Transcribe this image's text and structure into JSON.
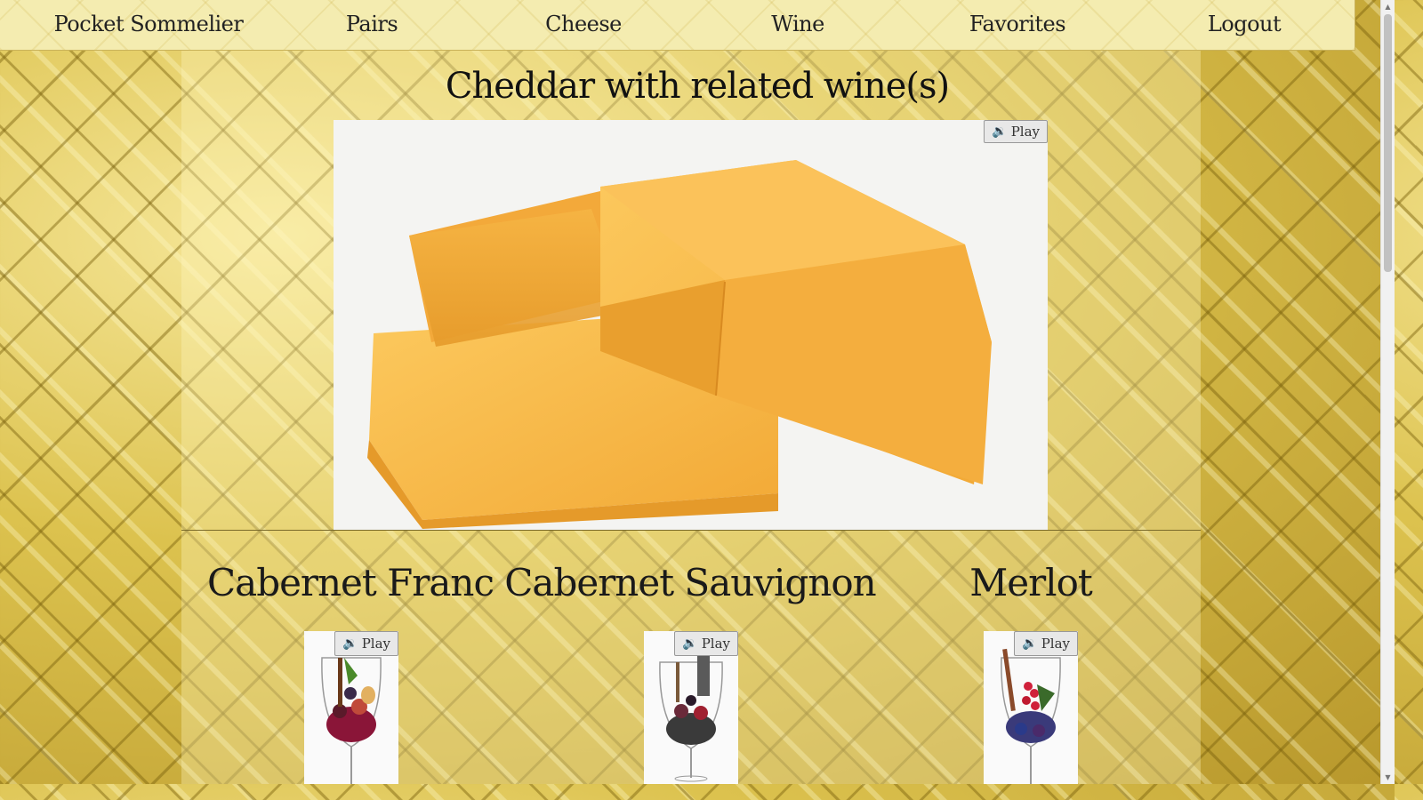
{
  "nav": {
    "brand": "Pocket Sommelier",
    "items": [
      "Pairs",
      "Cheese",
      "Wine",
      "Favorites",
      "Logout"
    ]
  },
  "page": {
    "title": "Cheddar with related wine(s)"
  },
  "hero": {
    "image_alt": "cheddar-cheese-photo",
    "play_label": "Play"
  },
  "wines": [
    {
      "name": "Cabernet Franc",
      "play_label": "Play"
    },
    {
      "name": "Cabernet Sauvignon",
      "play_label": "Play"
    },
    {
      "name": "Merlot",
      "play_label": "Play"
    }
  ],
  "icons": {
    "play": "speaker-icon"
  },
  "colors": {
    "cheese": "#f5b94a",
    "navbar": "#f4ecb0",
    "gold": "#d6bf4a"
  }
}
